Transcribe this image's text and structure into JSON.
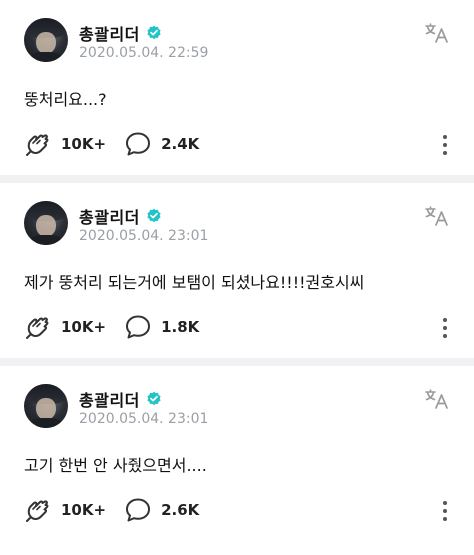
{
  "posts": [
    {
      "author": "총괄리더",
      "timestamp": "2020.05.04. 22:59",
      "text": "뚱처리요...?",
      "likes": "10K+",
      "comments": "2.4K"
    },
    {
      "author": "총괄리더",
      "timestamp": "2020.05.04. 23:01",
      "text": "제가 뚱처리 되는거에 보탬이 되셨나요!!!!권호시씨",
      "likes": "10K+",
      "comments": "1.8K"
    },
    {
      "author": "총괄리더",
      "timestamp": "2020.05.04. 23:01",
      "text": "고기 한번 안 사줬으면서....",
      "likes": "10K+",
      "comments": "2.6K"
    }
  ],
  "icons": {
    "verified": "verified-badge-icon",
    "translate": "translate-icon",
    "like": "like-hand-icon",
    "comment": "comment-bubble-icon",
    "more": "more-vertical-icon"
  },
  "colors": {
    "verified_badge": "#21c4c6",
    "timestamp": "#9aa0a6",
    "separator": "#f1f1f3",
    "icon_gray": "#9b9b9b"
  }
}
